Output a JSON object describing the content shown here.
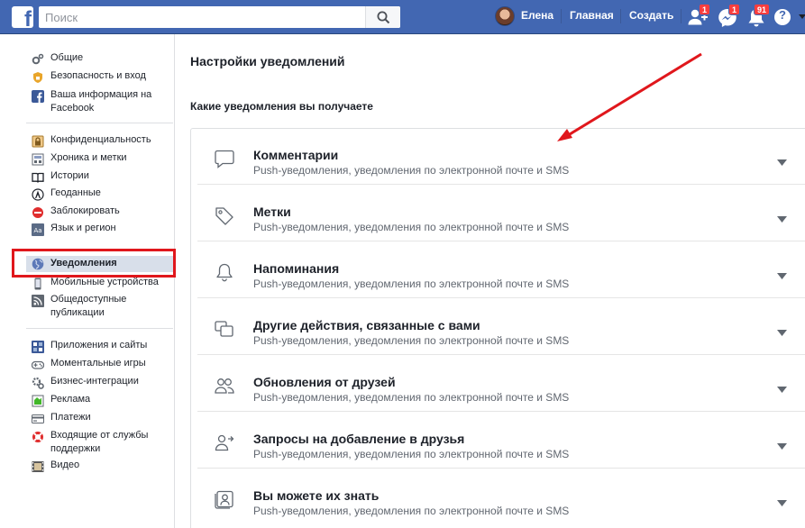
{
  "header": {
    "logo_letter": "f",
    "search_placeholder": "Поиск",
    "profile_name": "Елена",
    "home_label": "Главная",
    "create_label": "Создать",
    "friend_requests_badge": "1",
    "messages_badge": "1",
    "notifications_badge": "91",
    "help_glyph": "?",
    "colors": {
      "bar": "#4267b2",
      "badge": "#fa3e3e"
    },
    "icons": [
      "search-icon",
      "friend-requests-icon",
      "messenger-icon",
      "notifications-bell-icon",
      "help-icon",
      "account-menu-arrow-icon"
    ]
  },
  "sidebar": {
    "groups": [
      [
        {
          "label": "Общие",
          "icon": "gear-icon"
        },
        {
          "label": "Безопасность и вход",
          "icon": "shield-icon"
        },
        {
          "label": "Ваша информация на Facebook",
          "icon": "facebook-icon"
        }
      ],
      [
        {
          "label": "Конфиденциальность",
          "icon": "lock-icon"
        },
        {
          "label": "Хроника и метки",
          "icon": "timeline-icon"
        },
        {
          "label": "Истории",
          "icon": "book-icon"
        },
        {
          "label": "Геоданные",
          "icon": "location-icon"
        },
        {
          "label": "Заблокировать",
          "icon": "block-icon"
        },
        {
          "label": "Язык и регион",
          "icon": "language-icon"
        }
      ],
      [
        {
          "label": "Уведомления",
          "icon": "globe-icon",
          "active": true
        },
        {
          "label": "Мобильные устройства",
          "icon": "mobile-icon"
        },
        {
          "label": "Общедоступные публикации",
          "icon": "rss-icon"
        }
      ],
      [
        {
          "label": "Приложения и сайты",
          "icon": "apps-icon"
        },
        {
          "label": "Моментальные игры",
          "icon": "gamepad-icon"
        },
        {
          "label": "Бизнес-интеграции",
          "icon": "business-gear-icon"
        },
        {
          "label": "Реклама",
          "icon": "ads-icon"
        },
        {
          "label": "Платежи",
          "icon": "payments-icon"
        },
        {
          "label": "Входящие от службы поддержки",
          "icon": "lifebuoy-icon"
        },
        {
          "label": "Видео",
          "icon": "film-icon"
        }
      ]
    ]
  },
  "main": {
    "title": "Настройки уведомлений",
    "section_title": "Какие уведомления вы получаете",
    "rows": [
      {
        "title": "Комментарии",
        "subtitle": "Push-уведомления, уведомления по электронной почте и SMS",
        "icon": "comment-icon"
      },
      {
        "title": "Метки",
        "subtitle": "Push-уведомления, уведомления по электронной почте и SMS",
        "icon": "tag-icon"
      },
      {
        "title": "Напоминания",
        "subtitle": "Push-уведомления, уведомления по электронной почте и SMS",
        "icon": "bell-icon"
      },
      {
        "title": "Другие действия, связанные с вами",
        "subtitle": "Push-уведомления, уведомления по электронной почте и SMS",
        "icon": "activity-icon"
      },
      {
        "title": "Обновления от друзей",
        "subtitle": "Push-уведомления, уведомления по электронной почте и SMS",
        "icon": "friends-icon"
      },
      {
        "title": "Запросы на добавление в друзья",
        "subtitle": "Push-уведомления, уведомления по электронной почте и SMS",
        "icon": "add-friend-icon"
      },
      {
        "title": "Вы можете их знать",
        "subtitle": "Push-уведомления, уведомления по электронной почте и SMS",
        "icon": "people-you-may-know-icon"
      }
    ]
  },
  "annotations": {
    "highlight_color": "#e0171c",
    "shapes": [
      "sidebar-highlight-box",
      "red-arrow"
    ]
  }
}
